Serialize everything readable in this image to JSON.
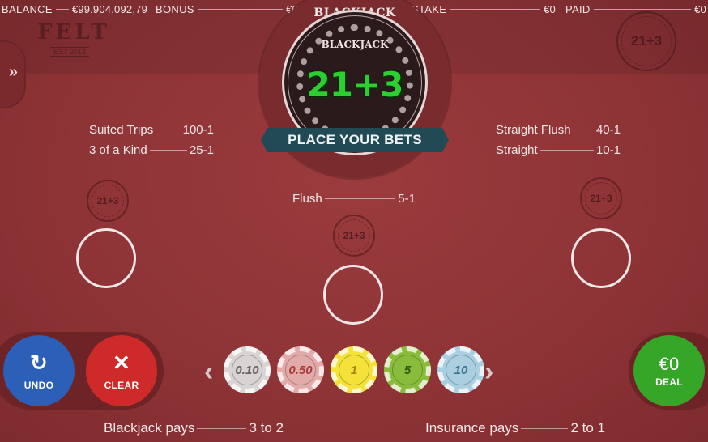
{
  "header": {
    "balance_label": "BALANCE",
    "balance_value": "€99.904.092,79",
    "bonus_label": "BONUS",
    "bonus_value": "€0",
    "stake_label": "STAKE",
    "stake_value": "€0",
    "paid_label": "PAID",
    "paid_value": "€0"
  },
  "logo": {
    "name": "FELT",
    "est": "EST 2013"
  },
  "menu_toggle": "»",
  "badge": {
    "top_title": "BLACKJACK",
    "inner_title": "BLACKJACK",
    "game": "21+3"
  },
  "banner": "PLACE YOUR BETS",
  "corner_stamp": "21+3",
  "spot_stamp": "21+3",
  "payouts": {
    "left": [
      {
        "name": "Suited Trips",
        "odds": "100-1"
      },
      {
        "name": "3 of a Kind",
        "odds": "25-1"
      }
    ],
    "right": [
      {
        "name": "Straight Flush",
        "odds": "40-1"
      },
      {
        "name": "Straight",
        "odds": "10-1"
      }
    ],
    "center": {
      "name": "Flush",
      "odds": "5-1"
    }
  },
  "buttons": {
    "undo": "UNDO",
    "clear": "CLEAR",
    "deal_amount": "€0",
    "deal": "DEAL"
  },
  "chips": [
    {
      "value": "0.10",
      "color": "#d9d4d4",
      "text": "#6a6060"
    },
    {
      "value": "0.50",
      "color": "#e3aaaa",
      "text": "#a73b3d"
    },
    {
      "value": "1",
      "color": "#f4e23a",
      "text": "#a58a00"
    },
    {
      "value": "5",
      "color": "#8abc3c",
      "text": "#2f5a10"
    },
    {
      "value": "10",
      "color": "#a9cfe0",
      "text": "#3f7390"
    }
  ],
  "footer": {
    "blackjack_label": "Blackjack pays",
    "blackjack_value": "3 to 2",
    "insurance_label": "Insurance pays",
    "insurance_value": "2 to 1"
  },
  "colors": {
    "felt": "#8e3437",
    "undo_button": "#2b5fb8",
    "clear_button": "#cf2a2a",
    "deal_button": "#35a628",
    "banner": "#224a55",
    "game_title": "#2bcf2f"
  }
}
